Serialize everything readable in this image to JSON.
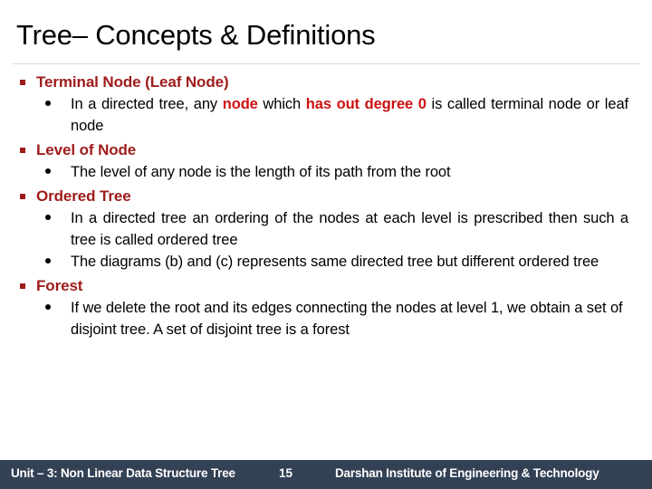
{
  "slide": {
    "title": "Tree– Concepts & Definitions",
    "colors": {
      "heading_red": "#9E1B1B",
      "emphasis_red": "#CC1111",
      "footer_bg": "#334155",
      "footer_text": "#FFFFFF",
      "body_text": "#000000",
      "rule": "#D9D9D9",
      "background": "#FFFFFF"
    },
    "bullets": [
      {
        "heading": "Terminal Node (Leaf Node)",
        "bullet_icon": "square-bullet-icon",
        "sub": [
          {
            "bullet_icon": "round-bullet-icon",
            "parts": [
              {
                "text": "In a directed tree, any ",
                "emphasis": false
              },
              {
                "text": "node",
                "emphasis": true
              },
              {
                "text": " which ",
                "emphasis": false
              },
              {
                "text": "has out degree 0",
                "emphasis": true
              },
              {
                "text": " is called terminal node or leaf node",
                "emphasis": false
              }
            ]
          }
        ]
      },
      {
        "heading": "Level of Node",
        "bullet_icon": "square-bullet-icon",
        "sub": [
          {
            "bullet_icon": "round-bullet-icon",
            "parts": [
              {
                "text": "The level of any node is the length of its path from the root",
                "emphasis": false
              }
            ]
          }
        ]
      },
      {
        "heading": "Ordered Tree",
        "bullet_icon": "square-bullet-icon",
        "sub": [
          {
            "bullet_icon": "round-bullet-icon",
            "parts": [
              {
                "text": "In a directed tree an ordering of the nodes at each level is prescribed then such a tree is called ordered tree",
                "emphasis": false
              }
            ]
          },
          {
            "bullet_icon": "round-bullet-icon",
            "parts": [
              {
                "text": "The diagrams (b) and (c) represents same directed tree but different ordered tree",
                "emphasis": false
              }
            ]
          }
        ]
      },
      {
        "heading": "Forest",
        "bullet_icon": "square-bullet-icon",
        "sub": [
          {
            "bullet_icon": "round-bullet-icon",
            "parts": [
              {
                "text": "If we delete the root and its edges connecting the nodes at level 1, we obtain a set of disjoint tree. A set of disjoint tree is a forest",
                "emphasis": false
              }
            ]
          }
        ]
      }
    ],
    "footer": {
      "unit_label": "Unit – 3: Non Linear Data Structure  Tree",
      "page_number": "15",
      "institute": "Darshan Institute of Engineering & Technology"
    }
  }
}
